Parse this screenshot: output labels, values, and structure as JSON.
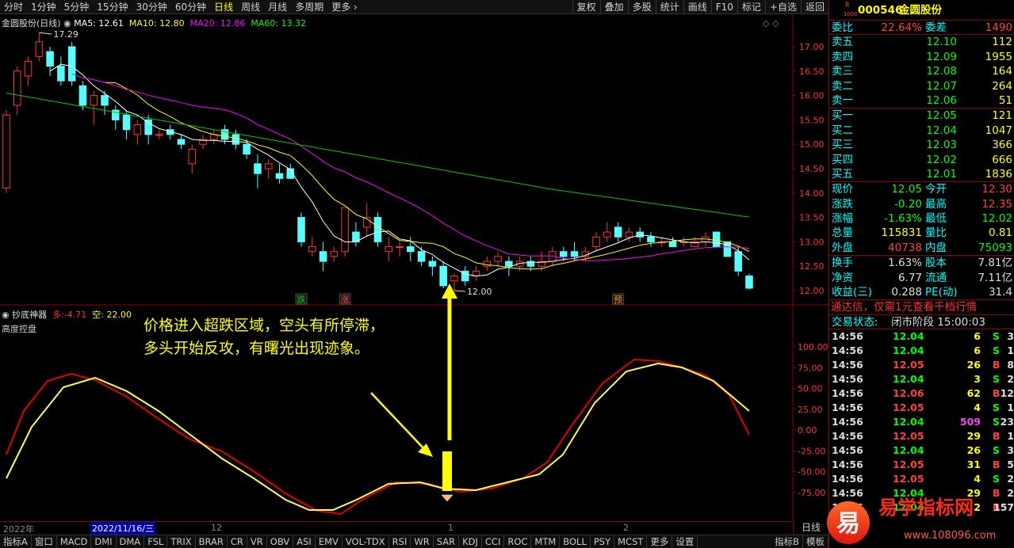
{
  "toolbar": {
    "periods": [
      "分时",
      "1分钟",
      "5分钟",
      "15分钟",
      "30分钟",
      "60分钟",
      "日线",
      "周线",
      "月线",
      "多周期",
      "更多"
    ],
    "active": "日线",
    "actions": [
      "复权",
      "叠加",
      "多股",
      "统计",
      "画线",
      "F10",
      "标记",
      "+自选",
      "返回"
    ]
  },
  "main_legend": {
    "title": "金圆股份(日线)",
    "ma5": "MA5: 12.61",
    "ma10": "MA10: 12.80",
    "ma20": "MA20: 12.86",
    "ma60": "MA60: 13.32"
  },
  "sub_legend": {
    "title": "抄底神器",
    "duo": "多:-4.71",
    "kong": "空: 22.00",
    "note": "高度控盘"
  },
  "annotation": {
    "line1": "价格进入超跌区域，空头有所停滞，",
    "line2": "多头开始反攻，有曙光出现迹象。"
  },
  "price_axis": [
    "17.00",
    "16.50",
    "16.00",
    "15.50",
    "15.00",
    "14.50",
    "14.00",
    "13.50",
    "13.00",
    "12.50",
    "12.00"
  ],
  "osc_axis": [
    "100.00",
    "75.00",
    "50.00",
    "25.00",
    "0.00",
    "-25.00",
    "-50.00",
    "-75.00"
  ],
  "labels": {
    "high": "17.29",
    "low": "12.00",
    "die": "跌",
    "zhang": "涨",
    "yu": "预"
  },
  "time_axis": {
    "y": "2022年",
    "date": "2022/11/16/三",
    "m12": "12",
    "m1": "1",
    "m2": "2"
  },
  "bottom_tabs": [
    "指标A",
    "窗口",
    "MACD",
    "DMI",
    "DMA",
    "FSL",
    "TRIX",
    "BRAR",
    "CR",
    "VR",
    "OBV",
    "ASI",
    "EMV",
    "VOL-TDX",
    "RSI",
    "WR",
    "SAR",
    "KDJ",
    "CCI",
    "ROC",
    "MTM",
    "BOLL",
    "PSY",
    "MCST",
    "更多",
    "设置"
  ],
  "bottom_right": [
    "指标B",
    "模板"
  ],
  "day_k": "日线",
  "stock": {
    "code": "000546",
    "name": "金圆股份",
    "badge": "R",
    "badge2": "1000"
  },
  "weibi": {
    "label": "委比",
    "value": "22.64%",
    "label2": "委差",
    "value2": "1490"
  },
  "asks": [
    {
      "l": "卖五",
      "p": "12.10",
      "v": "112"
    },
    {
      "l": "卖四",
      "p": "12.09",
      "v": "1955"
    },
    {
      "l": "卖三",
      "p": "12.08",
      "v": "164"
    },
    {
      "l": "卖二",
      "p": "12.07",
      "v": "264"
    },
    {
      "l": "卖一",
      "p": "12.06",
      "v": "51"
    }
  ],
  "bids": [
    {
      "l": "买一",
      "p": "12.05",
      "v": "121"
    },
    {
      "l": "买二",
      "p": "12.04",
      "v": "1047"
    },
    {
      "l": "买三",
      "p": "12.03",
      "v": "366"
    },
    {
      "l": "买四",
      "p": "12.02",
      "v": "666"
    },
    {
      "l": "买五",
      "p": "12.01",
      "v": "1836"
    }
  ],
  "quote": [
    {
      "a": "现价",
      "b": "12.05",
      "c": "今开",
      "d": "12.30"
    },
    {
      "a": "涨跌",
      "b": "-0.20",
      "c": "最高",
      "d": "12.35"
    },
    {
      "a": "涨幅",
      "b": "-1.63%",
      "c": "最低",
      "d": "12.02"
    },
    {
      "a": "总量",
      "b": "115831",
      "c": "量比",
      "d": "0.81"
    },
    {
      "a": "外盘",
      "b": "40738",
      "c": "内盘",
      "d": "75093"
    }
  ],
  "quote2": [
    {
      "a": "换手",
      "b": "1.63%",
      "c": "股本",
      "d": "7.81亿"
    },
    {
      "a": "净资",
      "b": "6.77",
      "c": "流通",
      "d": "7.11亿"
    },
    {
      "a": "收益(三)",
      "b": "0.288",
      "c": "PE(动)",
      "d": "31.4"
    }
  ],
  "promo": "通达信，仅需1元查看千档行情",
  "status": {
    "label": "交易状态:",
    "value": "闭市阶段 15:00:03"
  },
  "ticks": [
    {
      "t": "14:56",
      "p": "12.04",
      "v": "6",
      "d": "S",
      "n": "3"
    },
    {
      "t": "14:56",
      "p": "12.04",
      "v": "6",
      "d": "S",
      "n": "1"
    },
    {
      "t": "14:56",
      "p": "12.05",
      "v": "26",
      "d": "B",
      "n": "8"
    },
    {
      "t": "14:56",
      "p": "12.04",
      "v": "3",
      "d": "S",
      "n": "2"
    },
    {
      "t": "14:56",
      "p": "12.06",
      "v": "62",
      "d": "B",
      "n": "12"
    },
    {
      "t": "14:56",
      "p": "12.05",
      "v": "4",
      "d": "S",
      "n": "1"
    },
    {
      "t": "14:56",
      "p": "12.04",
      "v": "509",
      "d": "S",
      "n": "23"
    },
    {
      "t": "14:56",
      "p": "12.05",
      "v": "29",
      "d": "B",
      "n": "1"
    },
    {
      "t": "14:56",
      "p": "12.04",
      "v": "26",
      "d": "S",
      "n": "3"
    },
    {
      "t": "14:56",
      "p": "12.05",
      "v": "31",
      "d": "B",
      "n": "5"
    },
    {
      "t": "14:56",
      "p": "12.05",
      "v": "4",
      "d": "S",
      "n": "2"
    },
    {
      "t": "14:56",
      "p": "12.04",
      "v": "29",
      "d": "B",
      "n": "2"
    },
    {
      "t": "14:56",
      "p": "12.04",
      "v": "2",
      "d": "B",
      "n": "157"
    }
  ],
  "watermark": {
    "text": "易学指标网",
    "url": "www.108096.com",
    "logo": "易"
  }
}
